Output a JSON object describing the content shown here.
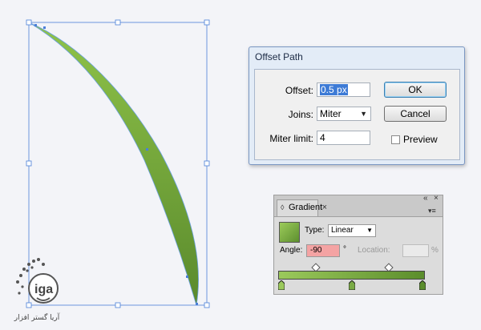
{
  "colors": {
    "leaf_light": "#8fc34a",
    "leaf_dark": "#5a8a2c",
    "selection": "#4a7fd8",
    "angle_field": "#f4a3a3"
  },
  "offset_dialog": {
    "title": "Offset Path",
    "offset_label": "Offset:",
    "offset_value": "0.5 px",
    "joins_label": "Joins:",
    "joins_value": "Miter",
    "miter_label": "Miter limit:",
    "miter_value": "4",
    "ok_label": "OK",
    "cancel_label": "Cancel",
    "preview_label": "Preview",
    "preview_checked": false
  },
  "gradient_panel": {
    "tab_label": "Gradient",
    "close_glyph": "×",
    "collapse_glyph": "«",
    "panel_close_glyph": "×",
    "type_label": "Type:",
    "type_value": "Linear",
    "angle_label": "Angle:",
    "angle_value": "-90",
    "degree_glyph": "°",
    "location_label": "Location:",
    "percent_glyph": "%"
  },
  "watermark": {
    "text": "آریا گستر افزار"
  }
}
